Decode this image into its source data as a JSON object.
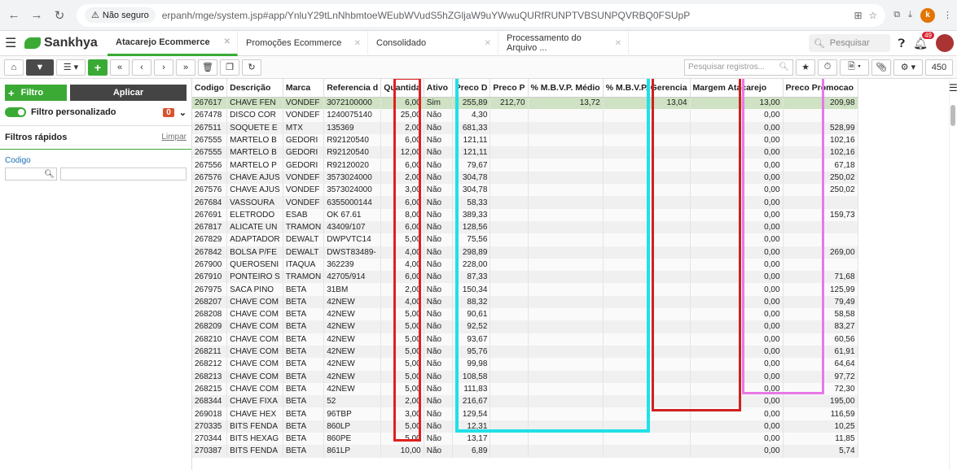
{
  "browser": {
    "secure_label": "Não seguro",
    "url": "erpanh/mge/system.jsp#app/YnluY29tLnNhbmtoeWEubWVudS5hZGljaW9uYWwuQURfRUNPTVBSUNPQVRBQ0FSUpP",
    "profile_letter": "k"
  },
  "app": {
    "logo": "Sankhya",
    "search_placeholder": "Pesquisar",
    "notif_count": "49"
  },
  "tabs": [
    {
      "label": "Atacarejo Ecommerce"
    },
    {
      "label": "Promoções Ecommerce"
    },
    {
      "label": "Consolidado"
    },
    {
      "label": "Processamento do Arquivo ..."
    }
  ],
  "toolbar": {
    "add_label": "+",
    "search_placeholder": "Pesquisar registros...",
    "page_size": "450"
  },
  "filter": {
    "filtro_label": "Filtro",
    "aplicar_label": "Aplicar",
    "custom_label": "Filtro personalizado",
    "custom_count": "0",
    "quick_label": "Filtros rápidos",
    "limpar_label": "Limpar",
    "codigo_label": "Codigo"
  },
  "columns": [
    "Codigo",
    "Descrição",
    "Marca",
    "Referencia d",
    "Quantida",
    "Ativo",
    "Preco D",
    "Preco P",
    "% M.B.V.P. Médio",
    "% M.B.V.P. Gerencia",
    "Margem Atacarejo",
    "Preco Promocao"
  ],
  "rows": [
    [
      "267617",
      "CHAVE FEN",
      "VONDEF",
      "3072100000",
      "6,00",
      "Sim",
      "255,89",
      "212,70",
      "13,72",
      "13,04",
      "13,00",
      "209,98"
    ],
    [
      "267478",
      "DISCO COR",
      "VONDEF",
      "1240075140",
      "25,00",
      "Não",
      "4,30",
      "",
      "",
      "",
      "0,00",
      ""
    ],
    [
      "267511",
      "SOQUETE E",
      "MTX",
      "135369",
      "2,00",
      "Não",
      "681,33",
      "",
      "",
      "",
      "0,00",
      "528,99"
    ],
    [
      "267555",
      "MARTELO B",
      "GEDORI",
      "R92120540",
      "6,00",
      "Não",
      "121,11",
      "",
      "",
      "",
      "0,00",
      "102,16"
    ],
    [
      "267555",
      "MARTELO B",
      "GEDORI",
      "R92120540",
      "12,00",
      "Não",
      "121,11",
      "",
      "",
      "",
      "0,00",
      "102,16"
    ],
    [
      "267556",
      "MARTELO P",
      "GEDORI",
      "R92120020",
      "6,00",
      "Não",
      "79,67",
      "",
      "",
      "",
      "0,00",
      "67,18"
    ],
    [
      "267576",
      "CHAVE AJUS",
      "VONDEF",
      "3573024000",
      "2,00",
      "Não",
      "304,78",
      "",
      "",
      "",
      "0,00",
      "250,02"
    ],
    [
      "267576",
      "CHAVE AJUS",
      "VONDEF",
      "3573024000",
      "3,00",
      "Não",
      "304,78",
      "",
      "",
      "",
      "0,00",
      "250,02"
    ],
    [
      "267684",
      "VASSOURA",
      "VONDEF",
      "6355000144",
      "6,00",
      "Não",
      "58,33",
      "",
      "",
      "",
      "0,00",
      ""
    ],
    [
      "267691",
      "ELETRODO",
      "ESAB",
      "OK 67.61",
      "8,00",
      "Não",
      "389,33",
      "",
      "",
      "",
      "0,00",
      "159,73"
    ],
    [
      "267817",
      "ALICATE UN",
      "TRAMON",
      "43409/107",
      "6,00",
      "Não",
      "128,56",
      "",
      "",
      "",
      "0,00",
      ""
    ],
    [
      "267829",
      "ADAPTADOR",
      "DEWALT",
      "DWPVTC14",
      "5,00",
      "Não",
      "75,56",
      "",
      "",
      "",
      "0,00",
      ""
    ],
    [
      "267842",
      "BOLSA P/FE",
      "DEWALT",
      "DWST83489-",
      "4,00",
      "Não",
      "298,89",
      "",
      "",
      "",
      "0,00",
      "269,00"
    ],
    [
      "267900",
      "QUEROSENI",
      "ITAQUA",
      "362239",
      "4,00",
      "Não",
      "228,00",
      "",
      "",
      "",
      "0,00",
      ""
    ],
    [
      "267910",
      "PONTEIRO S",
      "TRAMON",
      "42705/914",
      "6,00",
      "Não",
      "87,33",
      "",
      "",
      "",
      "0,00",
      "71,68"
    ],
    [
      "267975",
      "SACA PINO",
      "BETA",
      "31BM",
      "2,00",
      "Não",
      "150,34",
      "",
      "",
      "",
      "0,00",
      "125,99"
    ],
    [
      "268207",
      "CHAVE COM",
      "BETA",
      "42NEW",
      "4,00",
      "Não",
      "88,32",
      "",
      "",
      "",
      "0,00",
      "79,49"
    ],
    [
      "268208",
      "CHAVE COM",
      "BETA",
      "42NEW",
      "5,00",
      "Não",
      "90,61",
      "",
      "",
      "",
      "0,00",
      "58,58"
    ],
    [
      "268209",
      "CHAVE COM",
      "BETA",
      "42NEW",
      "5,00",
      "Não",
      "92,52",
      "",
      "",
      "",
      "0,00",
      "83,27"
    ],
    [
      "268210",
      "CHAVE COM",
      "BETA",
      "42NEW",
      "5,00",
      "Não",
      "93,67",
      "",
      "",
      "",
      "0,00",
      "60,56"
    ],
    [
      "268211",
      "CHAVE COM",
      "BETA",
      "42NEW",
      "5,00",
      "Não",
      "95,76",
      "",
      "",
      "",
      "0,00",
      "61,91"
    ],
    [
      "268212",
      "CHAVE COM",
      "BETA",
      "42NEW",
      "5,00",
      "Não",
      "99,98",
      "",
      "",
      "",
      "0,00",
      "64,64"
    ],
    [
      "268213",
      "CHAVE COM",
      "BETA",
      "42NEW",
      "5,00",
      "Não",
      "108,58",
      "",
      "",
      "",
      "0,00",
      "97,72"
    ],
    [
      "268215",
      "CHAVE COM",
      "BETA",
      "42NEW",
      "5,00",
      "Não",
      "111,83",
      "",
      "",
      "",
      "0,00",
      "72,30"
    ],
    [
      "268344",
      "CHAVE FIXA",
      "BETA",
      "52",
      "2,00",
      "Não",
      "216,67",
      "",
      "",
      "",
      "0,00",
      "195,00"
    ],
    [
      "269018",
      "CHAVE HEX",
      "BETA",
      "96TBP",
      "3,00",
      "Não",
      "129,54",
      "",
      "",
      "",
      "0,00",
      "116,59"
    ],
    [
      "270335",
      "BITS FENDA",
      "BETA",
      "860LP",
      "5,00",
      "Não",
      "12,31",
      "",
      "",
      "",
      "0,00",
      "10,25"
    ],
    [
      "270344",
      "BITS HEXAG",
      "BETA",
      "860PE",
      "5,00",
      "Não",
      "13,17",
      "",
      "",
      "",
      "0,00",
      "11,85"
    ],
    [
      "270387",
      "BITS FENDA",
      "BETA",
      "861LP",
      "10,00",
      "Não",
      "6,89",
      "",
      "",
      "",
      "0,00",
      "5,74"
    ]
  ],
  "highlight_colors": {
    "ativo": "#e02020",
    "preco_mbvp": "#20e0e8",
    "margem": "#d02020",
    "promocao": "#e878e8"
  }
}
